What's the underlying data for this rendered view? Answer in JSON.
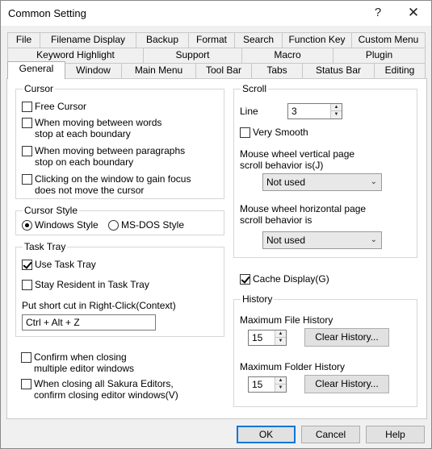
{
  "window": {
    "title": "Common Setting",
    "help_label": "?",
    "close_label": "✕"
  },
  "tabs": {
    "row1": [
      "File",
      "Filename Display",
      "Backup",
      "Format",
      "Search",
      "Function Key",
      "Custom Menu"
    ],
    "row2": [
      "Keyword Highlight",
      "Support",
      "Macro",
      "Plugin"
    ],
    "row3": [
      "General",
      "Window",
      "Main Menu",
      "Tool Bar",
      "Tabs",
      "Status Bar",
      "Editing"
    ],
    "active": "General"
  },
  "cursor": {
    "title": "Cursor",
    "free_cursor": {
      "label": "Free Cursor",
      "checked": false
    },
    "words": {
      "line1": "When moving between words",
      "line2": "stop at each boundary",
      "checked": false
    },
    "paragraphs": {
      "line1": "When moving between paragraphs",
      "line2": "stop on each boundary",
      "checked": false
    },
    "focus": {
      "line1": "Clicking on the window to gain focus",
      "line2": "does not move the cursor",
      "checked": false
    }
  },
  "cursor_style": {
    "title": "Cursor Style",
    "windows": {
      "label": "Windows Style",
      "checked": true
    },
    "msdos": {
      "label": "MS-DOS Style",
      "checked": false
    }
  },
  "task_tray": {
    "title": "Task Tray",
    "use": {
      "label": "Use Task Tray",
      "checked": true
    },
    "stay": {
      "label": "Stay Resident in Task Tray",
      "checked": false
    },
    "shortcut_label": "Put short cut in Right-Click(Context)",
    "shortcut_value": "Ctrl + Alt + Z"
  },
  "confirm_close": {
    "line1": "Confirm when closing",
    "line2": "multiple editor windows",
    "checked": false
  },
  "confirm_close_all": {
    "line1": "When closing all Sakura Editors,",
    "line2": "confirm closing editor windows(V)",
    "checked": false
  },
  "scroll": {
    "title": "Scroll",
    "line_label": "Line",
    "line_value": "3",
    "very_smooth": {
      "label": "Very Smooth",
      "checked": false
    },
    "vertical_label1": "Mouse wheel vertical page",
    "vertical_label2": "scroll behavior is(J)",
    "vertical_value": "Not used",
    "horizontal_label1": "Mouse wheel horizontal page",
    "horizontal_label2": "scroll behavior is",
    "horizontal_value": "Not used"
  },
  "cache_display": {
    "label": "Cache Display(G)",
    "checked": true
  },
  "history": {
    "title": "History",
    "max_file_label": "Maximum File History",
    "max_file_value": "15",
    "clear_file": "Clear History...",
    "max_folder_label": "Maximum Folder History",
    "max_folder_value": "15",
    "clear_folder": "Clear History..."
  },
  "footer": {
    "ok": "OK",
    "cancel": "Cancel",
    "help": "Help"
  }
}
